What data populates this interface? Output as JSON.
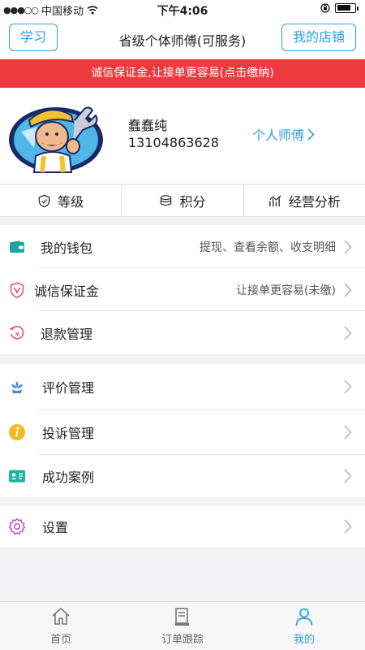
{
  "status": {
    "signal": "●●●○○",
    "carrier": "中国移动",
    "time": "下午4:06"
  },
  "header": {
    "left_button": "学习",
    "title": "省级个体师傅(可服务)",
    "right_button": "我的店铺"
  },
  "banner": "诚信保证金,让接单更容易(点击缴纳)",
  "profile": {
    "name": "蠢蠢纯",
    "phone": "13104863628",
    "link": "个人师傅"
  },
  "stats": [
    {
      "label": "等级",
      "icon": "shield-check-icon"
    },
    {
      "label": "积分",
      "icon": "coins-icon"
    },
    {
      "label": "经营分析",
      "icon": "chart-icon"
    }
  ],
  "menu_group1": [
    {
      "label": "我的钱包",
      "value": "提现、查看余额、收支明细",
      "icon": "wallet-icon",
      "color": "#1aa89d"
    },
    {
      "label": "诚信保证金",
      "value": "让接单更容易(未缴)",
      "icon": "v-shield-icon",
      "color": "#e94f5a"
    },
    {
      "label": "退款管理",
      "value": "",
      "icon": "refund-icon",
      "color": "#e94f7a"
    }
  ],
  "menu_group2": [
    {
      "label": "评价管理",
      "value": "",
      "icon": "flower-icon",
      "color": "#3f8fe0"
    },
    {
      "label": "投诉管理",
      "value": "",
      "icon": "info-icon",
      "color": "#f5b823"
    },
    {
      "label": "成功案例",
      "value": "",
      "icon": "id-card-icon",
      "color": "#1bb5a0"
    }
  ],
  "menu_group3": [
    {
      "label": "设置",
      "value": "",
      "icon": "gear-icon",
      "color": "#c451c9"
    }
  ],
  "tabs": [
    {
      "label": "首页",
      "icon": "home-icon"
    },
    {
      "label": "订单跟踪",
      "icon": "order-icon"
    },
    {
      "label": "我的",
      "icon": "user-icon"
    }
  ],
  "accent": "#2d9fe0",
  "banner_color": "#ee3a3f"
}
